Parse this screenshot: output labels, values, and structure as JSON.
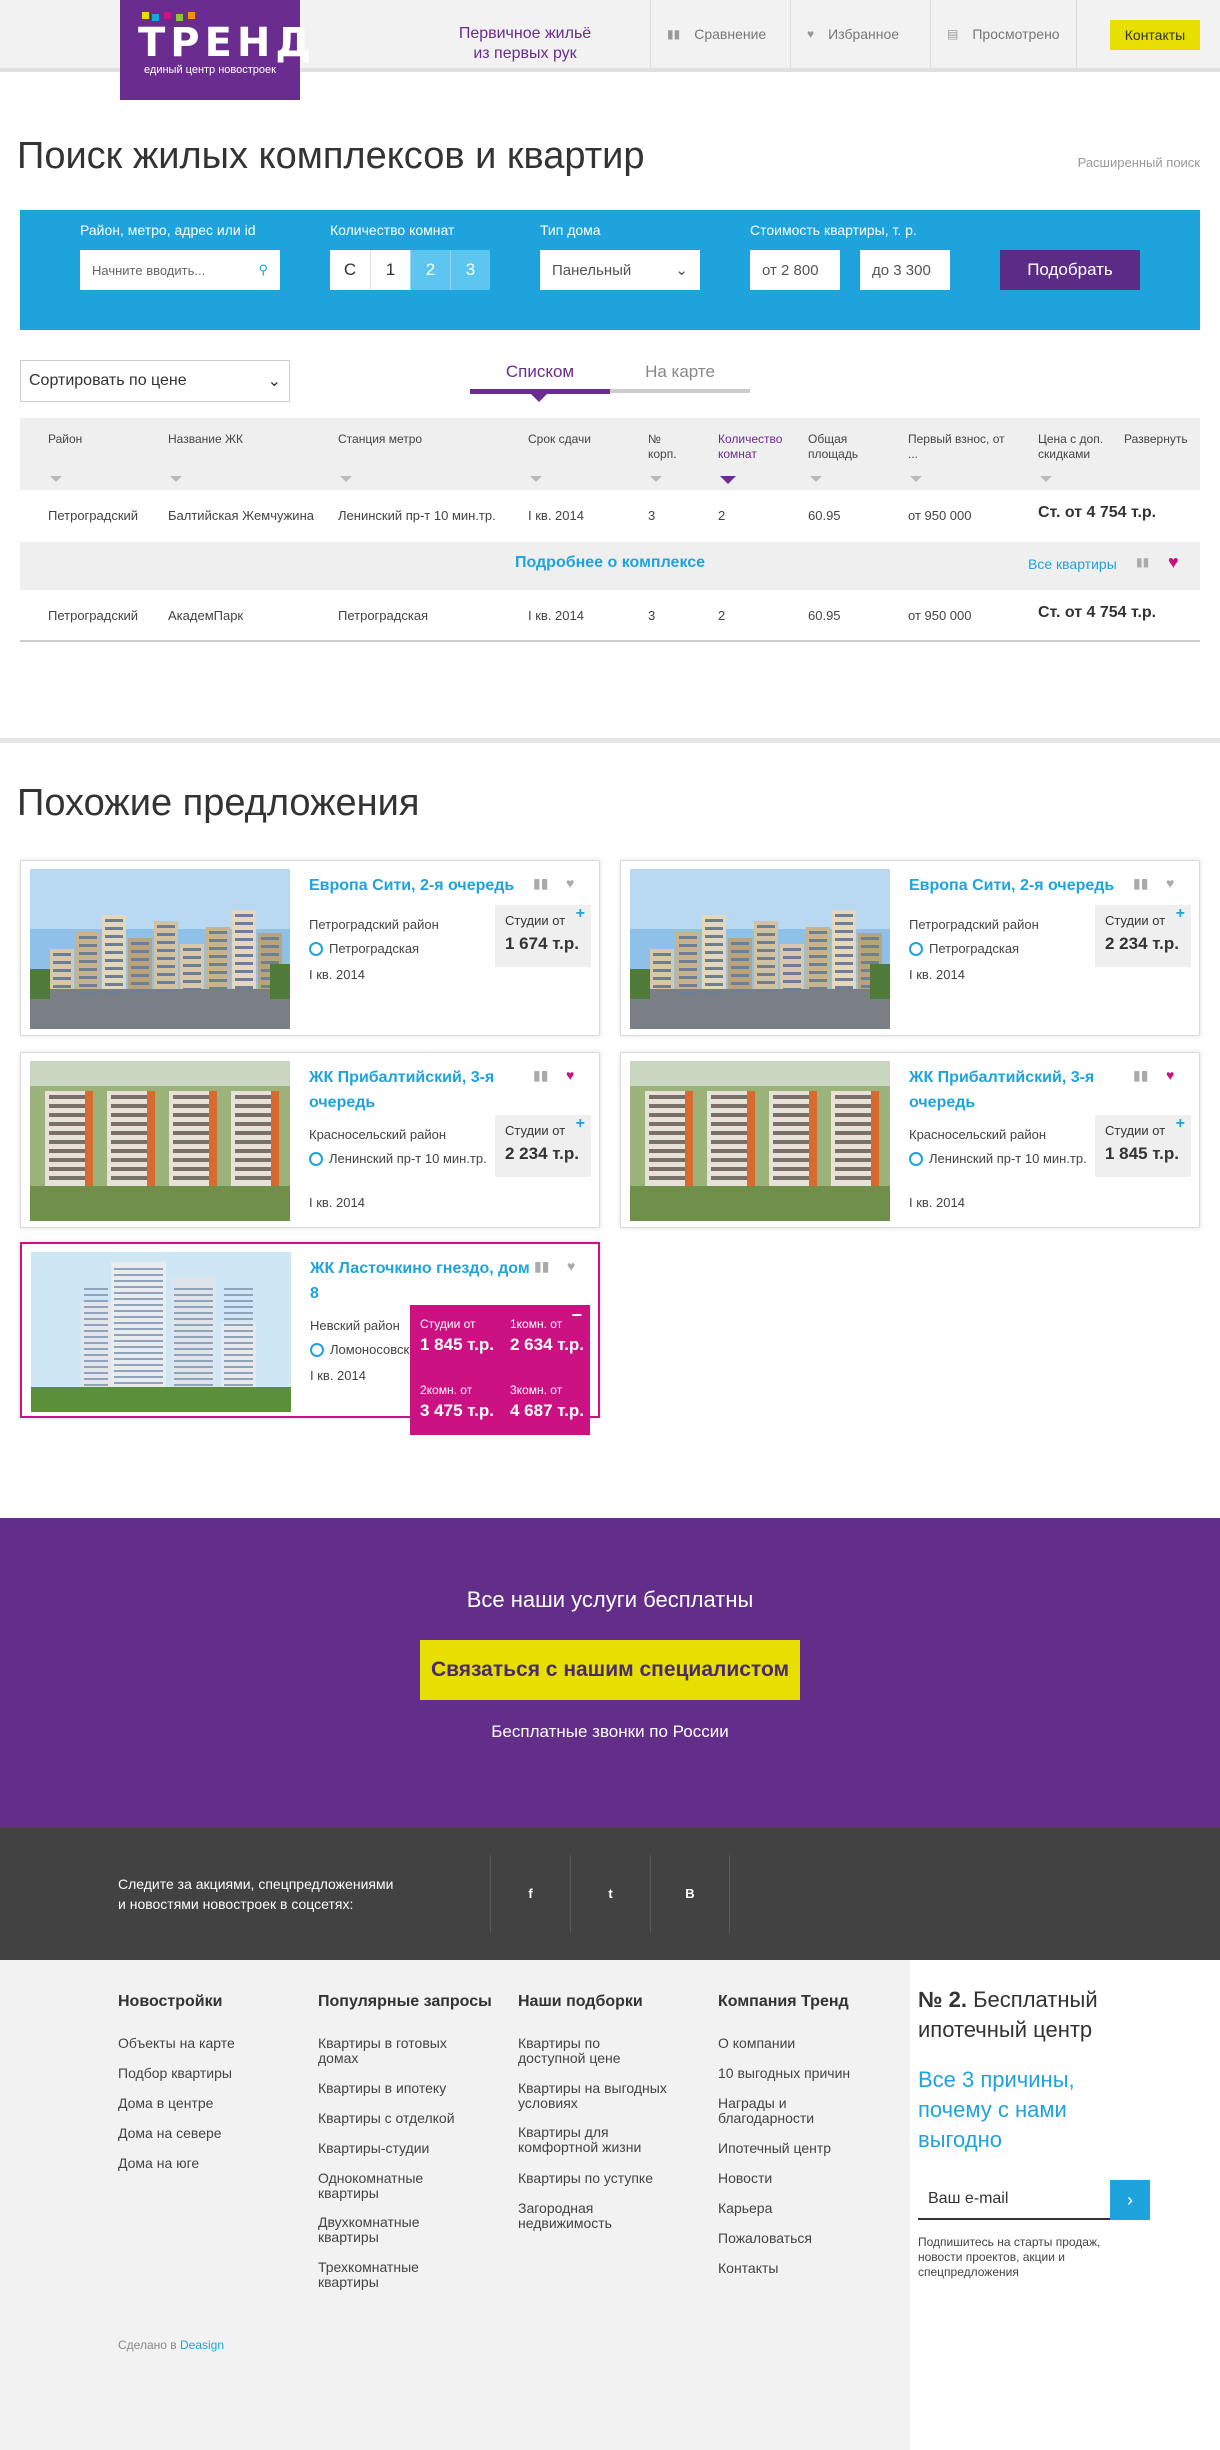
{
  "header": {
    "logo_text": "ТРЕНД",
    "logo_sub": "единый центр новостроек",
    "tagline_1": "Первичное жильё",
    "tagline_2": "из первых рук",
    "nav_compare": "Сравнение",
    "nav_favorites": "Избранное",
    "nav_viewed": "Просмотрено",
    "contacts": "Контакты"
  },
  "search": {
    "title": "Поиск жилых комплексов и квартир",
    "advanced": "Расширенный поиск",
    "district_label": "Район, метро, адрес или id",
    "district_placeholder": "Начните вводить...",
    "rooms_label": "Количество комнат",
    "rooms": [
      "С",
      "1",
      "2",
      "3"
    ],
    "house_label": "Тип дома",
    "house_value": "Панельный",
    "price_label": "Стоимость квартиры, т. р.",
    "price_from": "от 2 800",
    "price_to": "до 3 300",
    "submit": "Подобрать"
  },
  "listing": {
    "sort": "Сортировать по цене",
    "tab_list": "Списком",
    "tab_map": "На карте",
    "expand": "Развернуть",
    "columns": [
      "Район",
      "Название ЖК",
      "Станция метро",
      "Срок сдачи",
      "№ корп.",
      "Количество комнат",
      "Общая площадь",
      "Первый взнос, от ...",
      "Цена с доп. скидками"
    ],
    "rows": [
      {
        "district": "Петроградский",
        "name": "Балтийская Жемчужина",
        "metro": "Ленинский пр-т 10 мин.тр.",
        "date": "I кв. 2014",
        "building": "3",
        "rooms": "2",
        "area": "60.95",
        "first": "от 950 000",
        "price": "Ст. от 4 754 т.р."
      },
      {
        "district": "Петроградский",
        "name": "АкадемПарк",
        "metro": "Петроградская",
        "date": "I кв. 2014",
        "building": "3",
        "rooms": "2",
        "area": "60.95",
        "first": "от 950 000",
        "price": "Ст. от 4 754 т.р."
      }
    ],
    "more_complex": "Подробнее о комплексе",
    "all_apartments": "Все квартиры"
  },
  "similar": {
    "title": "Похожие предложения",
    "price_label": "Студии от",
    "cards": [
      {
        "title": "Европа Сити, 2-я очередь",
        "district": "Петроградский район",
        "metro": "Петроградская",
        "date": "I кв. 2014",
        "price": "1 674 т.р."
      },
      {
        "title": "Европа Сити, 2-я очередь",
        "district": "Петроградский район",
        "metro": "Петроградская",
        "date": "I кв. 2014",
        "price": "2 234 т.р."
      },
      {
        "title": "ЖК Прибалтийский, 3-я очередь",
        "district": "Красносельский район",
        "metro": "Ленинский пр-т 10 мин.тр.",
        "date": "I кв. 2014",
        "price": "2 234 т.р."
      },
      {
        "title": "ЖК Прибалтийский, 3-я очередь",
        "district": "Красносельский район",
        "metro": "Ленинский пр-т 10 мин.тр.",
        "date": "I кв. 2014",
        "price": "1 845 т.р."
      },
      {
        "title": "ЖК Ласточкино гнездо, дом 8",
        "district": "Невский район",
        "metro": "Ломоносовская",
        "date": "I кв. 2014"
      }
    ],
    "popup": {
      "studio_label": "Студии от",
      "studio": "1 845 т.р.",
      "one_label": "1комн. от",
      "one": "2 634 т.р.",
      "two_label": "2комн. от",
      "two": "3 475 т.р.",
      "three_label": "3комн. от",
      "three": "4 687 т.р."
    }
  },
  "cta": {
    "title": "Все наши услуги бесплатны",
    "button": "Связаться с нашим специалистом",
    "sub": "Бесплатные звонки по России"
  },
  "social": {
    "text_1": "Следите за акциями, спецпредложениями",
    "text_2": "и новостями новостроек в соцсетях:",
    "fb": "f",
    "tw": "t",
    "vk": "B"
  },
  "footer": {
    "col1": {
      "title": "Новостройки",
      "links": [
        "Объекты на карте",
        "Подбор квартиры",
        "Дома в центре",
        "Дома на севере",
        "Дома на юге"
      ]
    },
    "col2": {
      "title": "Популярные запросы",
      "links": [
        "Квартиры в готовых домах",
        "Квартиры в ипотеку",
        "Квартиры с отделкой",
        "Квартиры-студии",
        "Однокомнатные квартиры",
        "Двухкомнатные квартиры",
        "Трехкомнатные квартиры"
      ]
    },
    "col3": {
      "title": "Наши подборки",
      "links": [
        "Квартиры по доступной цене",
        "Квартиры на выгодных условиях",
        "Квартиры для комфортной жизни",
        "Квартиры по уступке",
        "Загородная недвижимость"
      ]
    },
    "col4": {
      "title": "Компания Тренд",
      "links": [
        "О компании",
        "10 выгодных причин",
        "Награды и благодарности",
        "Ипотечный центр",
        "Новости",
        "Карьера",
        "Пожаловаться",
        "Контакты"
      ]
    },
    "mortgage_num": "№ 2.",
    "mortgage_text": "Бесплатный ипотечный центр",
    "why": "Все 3 причины, почему с нами выгодно",
    "email_placeholder": "Ваш e-mail",
    "note": "Подпишитесь на старты продаж, новости проектов, акции и спецпредложения",
    "made_in": "Сделано в",
    "made_brand": "Deasign"
  },
  "colors": {
    "purple": "#632d8a",
    "blue": "#1fa3dc",
    "yellow": "#e6df00",
    "pink": "#cc1183"
  }
}
